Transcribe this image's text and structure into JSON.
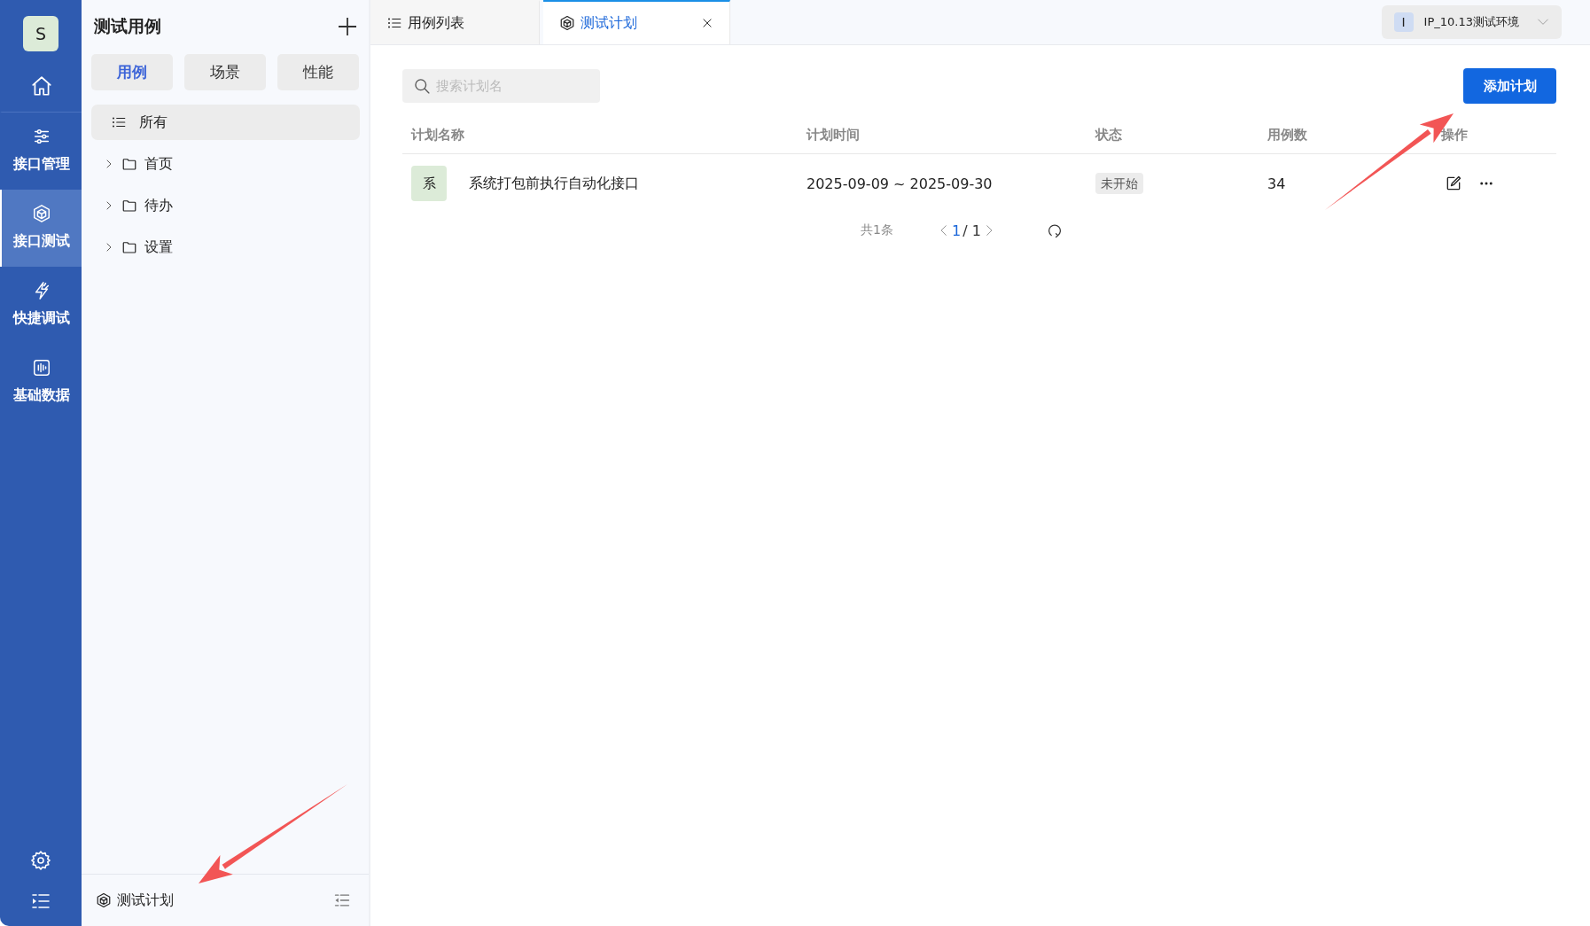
{
  "nav_rail": {
    "avatar": "S",
    "items": [
      {
        "selected": false
      },
      {
        "label": "接口管理",
        "selected": false
      },
      {
        "label": "接口测试",
        "selected": true
      },
      {
        "label": "快捷调试",
        "selected": false
      },
      {
        "label": "基础数据",
        "selected": false
      }
    ]
  },
  "sidebar": {
    "title": "测试用例",
    "segments": [
      {
        "label": "用例",
        "selected": true
      },
      {
        "label": "场景",
        "selected": false
      },
      {
        "label": "性能",
        "selected": false
      }
    ],
    "tree": [
      {
        "label": "所有",
        "kind": "all",
        "selected": true
      },
      {
        "label": "首页",
        "kind": "folder",
        "selected": false,
        "expanded": false
      },
      {
        "label": "待办",
        "kind": "folder",
        "selected": false,
        "expanded": false
      },
      {
        "label": "设置",
        "kind": "folder",
        "selected": false,
        "expanded": false
      }
    ],
    "footer": {
      "label": "测试计划"
    }
  },
  "tabs": [
    {
      "label": "用例列表",
      "selected": false,
      "closable": false
    },
    {
      "label": "测试计划",
      "selected": true,
      "closable": true
    }
  ],
  "environment": {
    "badge": "I",
    "label": "IP_10.13测试环境"
  },
  "search": {
    "placeholder": "搜索计划名"
  },
  "add_button": "添加计划",
  "table": {
    "columns": [
      "计划名称",
      "计划时间",
      "状态",
      "用例数",
      "操作"
    ],
    "rows": [
      {
        "avatar": "系",
        "name": "系统打包前执行自动化接口",
        "time": "2025-09-09 ~ 2025-09-30",
        "status": "未开始",
        "count": "34"
      }
    ]
  },
  "pagination": {
    "total": "共1条",
    "page": "1",
    "of": "/ 1"
  }
}
